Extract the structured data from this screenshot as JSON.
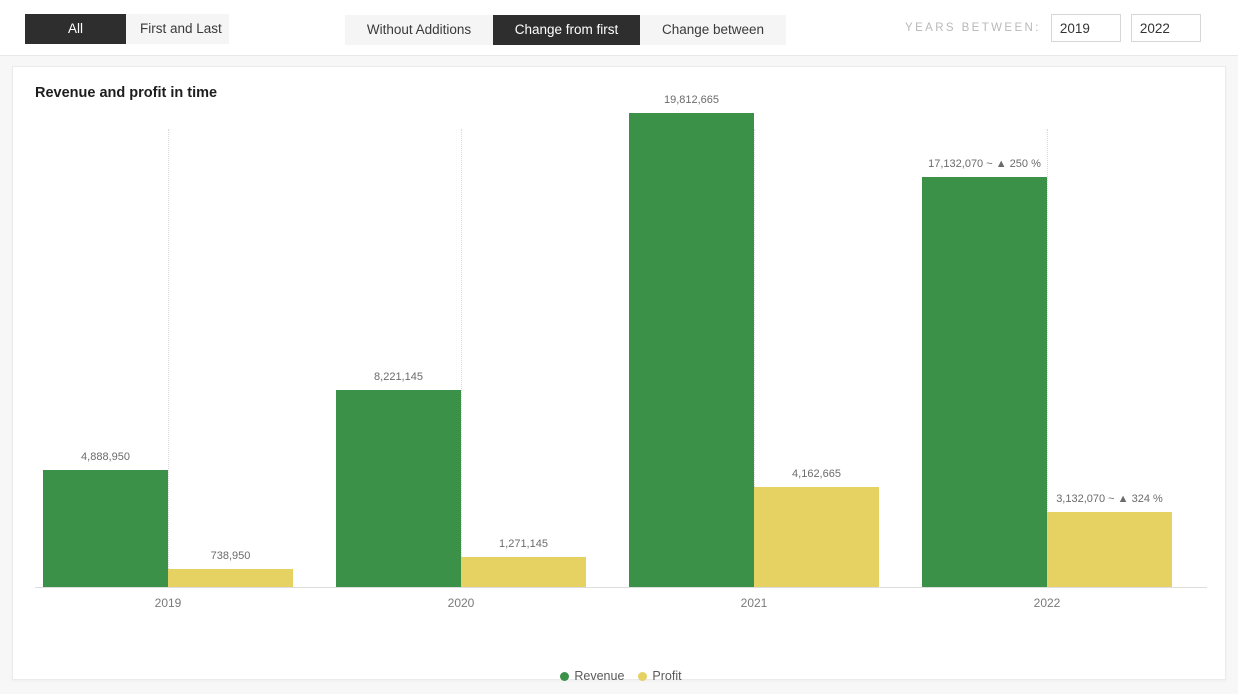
{
  "toolbar": {
    "scope_group": {
      "name": "scope-toggle",
      "options": [
        {
          "label": "All",
          "active": true
        },
        {
          "label": "First and Last",
          "active": false
        }
      ]
    },
    "mode_group": {
      "name": "mode-toggle",
      "options": [
        {
          "label": "Without Additions",
          "active": false
        },
        {
          "label": "Change from first",
          "active": true
        },
        {
          "label": "Change between",
          "active": false
        }
      ]
    },
    "years_between": {
      "label": "YEARS BETWEEN:",
      "from_value": "2019",
      "to_value": "2022",
      "from_placeholder": "2019",
      "to_placeholder": "2022"
    }
  },
  "card": {
    "title": "Revenue and profit in time"
  },
  "chart_data": {
    "type": "bar",
    "title": "Revenue and profit in time",
    "xlabel": "",
    "ylabel": "",
    "grid": true,
    "legend_position": "bottom",
    "categories": [
      "2019",
      "2020",
      "2021",
      "2022"
    ],
    "ylim": [
      0,
      19812665
    ],
    "series": [
      {
        "name": "Revenue",
        "color": "#3b9147",
        "values": [
          4888950,
          8221145,
          19812665,
          17132070
        ],
        "labels": [
          "4,888,950",
          "8,221,145",
          "19,812,665",
          "17,132,070 ~ ▲ 250 %"
        ]
      },
      {
        "name": "Profit",
        "color": "#e6d163",
        "values": [
          738950,
          1271145,
          4162665,
          3132070
        ],
        "labels": [
          "738,950",
          "1,271,145",
          "4,162,665",
          "3,132,070 ~ ▲ 324 %"
        ]
      }
    ],
    "annotations": [
      {
        "category": "2022",
        "series": "Revenue",
        "change": "250 %",
        "direction": "up"
      },
      {
        "category": "2022",
        "series": "Profit",
        "change": "324 %",
        "direction": "up"
      }
    ],
    "legend": [
      {
        "label": "Revenue",
        "color": "#3b9147"
      },
      {
        "label": "Profit",
        "color": "#e6d163"
      }
    ]
  }
}
